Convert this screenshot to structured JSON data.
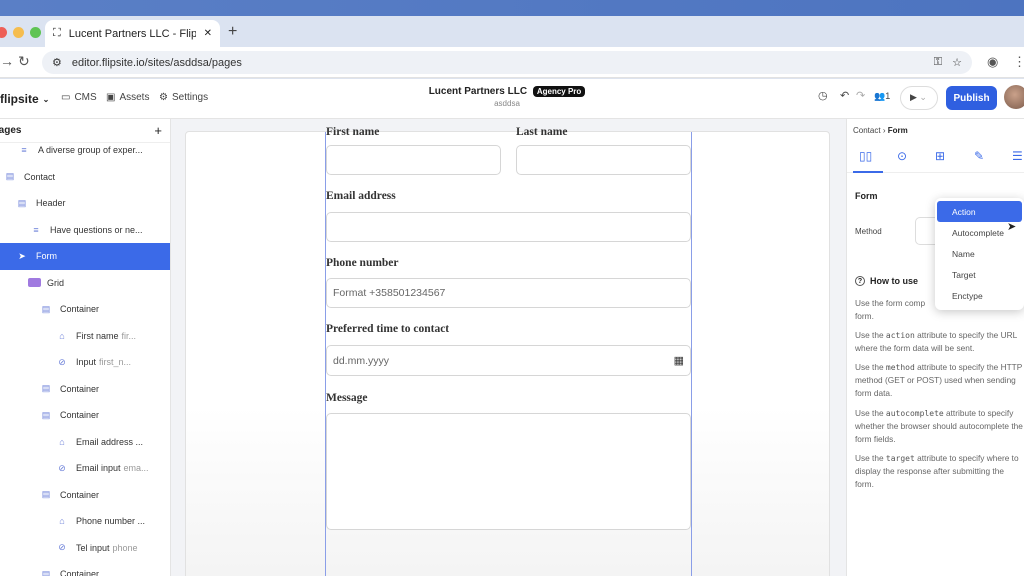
{
  "browser": {
    "tab_title": "Lucent Partners LLC - Flipsite",
    "url": "editor.flipsite.io/sites/asddsa/pages",
    "new_tab_icon": "+"
  },
  "app": {
    "brand": "flipsite",
    "nav": [
      {
        "label": "CMS",
        "icon": "book-icon"
      },
      {
        "label": "Assets",
        "icon": "image-icon"
      },
      {
        "label": "Settings",
        "icon": "gear-icon"
      }
    ],
    "site_title": "Lucent Partners LLC",
    "plan_badge": "Agency Pro",
    "site_sub": "asddsa",
    "collab_count": "1",
    "publish_label": "Publish"
  },
  "left_panel": {
    "title": "Pages",
    "items": [
      {
        "label": "A diverse group of exper...",
        "muted": "",
        "icon": "text-icon",
        "indent": 18
      },
      {
        "label": "Contact",
        "muted": "",
        "icon": "section-icon",
        "indent": 4
      },
      {
        "label": "Header",
        "muted": "",
        "icon": "section-icon",
        "indent": 16
      },
      {
        "label": "Have questions or ne...",
        "muted": "",
        "icon": "text-icon",
        "indent": 30
      },
      {
        "label": "Form",
        "muted": "",
        "icon": "send-icon",
        "indent": 16,
        "selected": true
      },
      {
        "label": "Grid",
        "muted": "",
        "icon": "grid-icon",
        "indent": 28
      },
      {
        "label": "Container",
        "muted": "",
        "icon": "section-icon",
        "indent": 40
      },
      {
        "label": "First name",
        "muted": "fir...",
        "icon": "tag-icon",
        "indent": 56
      },
      {
        "label": "Input",
        "muted": "first_n...",
        "icon": "link-icon",
        "indent": 56
      },
      {
        "label": "Container",
        "muted": "",
        "icon": "section-icon",
        "indent": 40
      },
      {
        "label": "Container",
        "muted": "",
        "icon": "section-icon",
        "indent": 40
      },
      {
        "label": "Email address ...",
        "muted": "",
        "icon": "tag-icon",
        "indent": 56
      },
      {
        "label": "Email input",
        "muted": "ema...",
        "icon": "link-icon",
        "indent": 56
      },
      {
        "label": "Container",
        "muted": "",
        "icon": "section-icon",
        "indent": 40
      },
      {
        "label": "Phone number ...",
        "muted": "",
        "icon": "tag-icon",
        "indent": 56
      },
      {
        "label": "Tel input",
        "muted": "phone",
        "icon": "link-icon",
        "indent": 56
      },
      {
        "label": "Container",
        "muted": "",
        "icon": "section-icon",
        "indent": 40
      }
    ]
  },
  "form": {
    "first_name_label": "First name",
    "last_name_label": "Last name",
    "email_label": "Email address",
    "phone_label": "Phone number",
    "phone_placeholder": "Format +358501234567",
    "time_label": "Preferred time to contact",
    "date_placeholder": "dd.mm.yyyy",
    "message_label": "Message"
  },
  "right_panel": {
    "breadcrumb_parent": "Contact",
    "breadcrumb_current": "Form",
    "section_title": "Form",
    "method_label": "Method",
    "howto_title": "How to use",
    "help": {
      "intro_a": "Use the form comp",
      "intro_b": "form.",
      "action_pre": "Use the",
      "action_code": "action",
      "action_post": "attribute to specify the URL where the form data will be sent.",
      "method_pre": "Use the",
      "method_code": "method",
      "method_post": "attribute to specify the HTTP method (GET or POST) used when sending form data.",
      "auto_pre": "Use the",
      "auto_code": "autocomplete",
      "auto_post": "attribute to specify whether the browser should autocomplete the form fields.",
      "target_pre": "Use the",
      "target_code": "target",
      "target_post": "attribute to specify where to display the response after submitting the form."
    },
    "dropdown": [
      "Action",
      "Autocomplete",
      "Name",
      "Target",
      "Enctype"
    ]
  },
  "colors": {
    "accent": "#3b6ae8",
    "publish": "#2f5fe0"
  }
}
